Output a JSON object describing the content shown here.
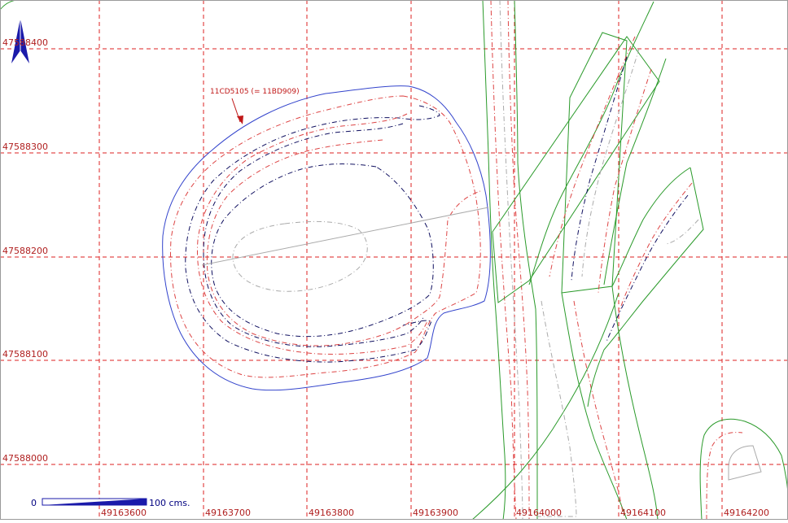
{
  "map": {
    "x_labels": [
      "49163600",
      "49163700",
      "49163800",
      "49163900",
      "49164000",
      "49164100",
      "49164200"
    ],
    "y_labels": [
      "47588400",
      "47588300",
      "47588200",
      "47588100",
      "47588000"
    ],
    "feature_label": "11CD5105 (= 11BD909)",
    "scale_bar": {
      "start_label": "0",
      "end_label": "100 cms."
    },
    "colors": {
      "grid": "#dd2222",
      "outline_blue": "#3344cc",
      "contour_navy": "#101060",
      "contour_red": "#dd4444",
      "contour_grey": "#aaaaaa",
      "green_features": "#2a9a2a",
      "north_arrow": "#1a1aaa"
    }
  }
}
